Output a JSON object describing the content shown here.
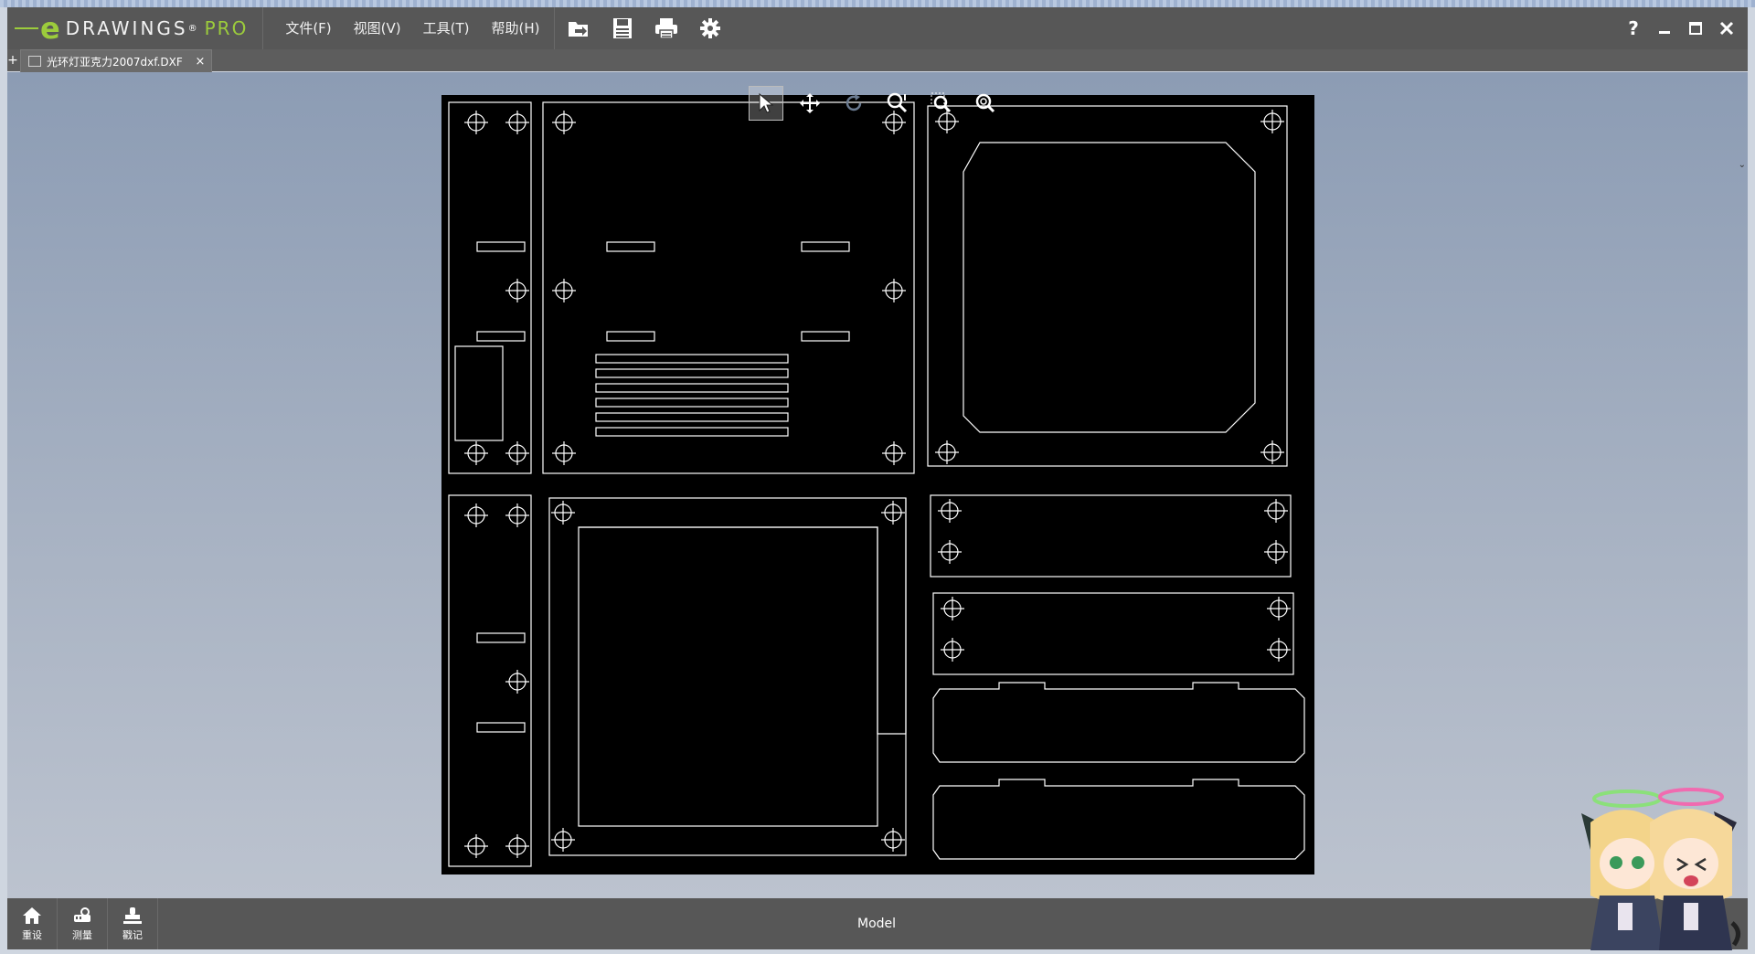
{
  "app": {
    "logo_word": "DRAWINGS",
    "logo_pro": "PRO",
    "menu": [
      {
        "label": "文件(F)"
      },
      {
        "label": "视图(V)"
      },
      {
        "label": "工具(T)"
      },
      {
        "label": "帮助(H)"
      }
    ],
    "help_label": "?",
    "colors": {
      "accent": "#9ccc3c",
      "titlebar": "#575757",
      "canvas": "#000000",
      "lines": "#ffffff"
    }
  },
  "tabs": {
    "plus_label": "+",
    "active_document": "光环灯亚克力2007dxf.DXF",
    "close_label": "×"
  },
  "view_toolbar": {
    "icons": [
      "select-icon",
      "pan-icon",
      "rotate-icon",
      "zoom-icon",
      "zoom-to-area-icon",
      "zoom-to-fit-icon"
    ]
  },
  "bottom": {
    "buttons": [
      {
        "label": "重设",
        "icon": "home-icon"
      },
      {
        "label": "测量",
        "icon": "measure-icon"
      },
      {
        "label": "戳记",
        "icon": "stamp-icon"
      }
    ],
    "sheet_label": "Model"
  }
}
